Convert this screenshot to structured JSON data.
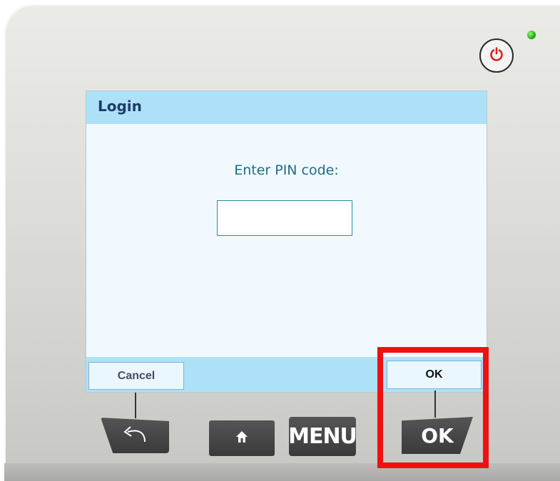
{
  "dialog": {
    "title": "Login",
    "prompt": "Enter PIN code:",
    "pin_value": "",
    "softkeys": {
      "cancel_label": "Cancel",
      "ok_label": "OK"
    }
  },
  "hardware_buttons": {
    "back_icon": "back-arrow-icon",
    "home_icon": "home-icon",
    "menu_label": "MENU",
    "ok_label": "OK",
    "power_icon": "power-icon"
  },
  "colors": {
    "title_bar": "#ade1f8",
    "screen_bg": "#f1f9fe",
    "highlight": "#ee1111",
    "power_symbol": "#e02020",
    "led": "#1d9b12"
  }
}
